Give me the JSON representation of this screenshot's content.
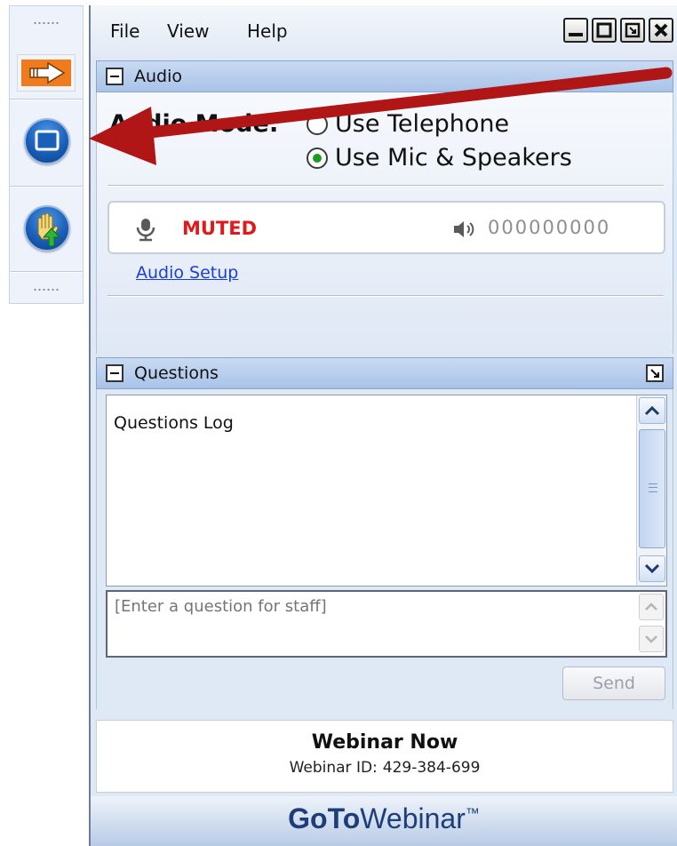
{
  "window": {
    "menu": [
      "File",
      "View",
      "Help"
    ],
    "controls": [
      "minimize-icon",
      "maximize-icon",
      "restore-icon",
      "close-icon"
    ]
  },
  "toolbar": {
    "items": [
      "arrow-right-icon",
      "screen-share-icon",
      "raise-hand-icon"
    ]
  },
  "audio": {
    "title": "Audio",
    "mode_label": "Audio Mode:",
    "options": [
      {
        "label": "Use Telephone",
        "selected": false
      },
      {
        "label": "Use Mic & Speakers",
        "selected": true
      }
    ],
    "mic_status": "MUTED",
    "speaker_level": "000000000",
    "setup_link": "Audio Setup"
  },
  "questions": {
    "title": "Questions",
    "log_text": "Questions Log",
    "input_placeholder": "[Enter a question for staff]",
    "send_label": "Send"
  },
  "webinar": {
    "name": "Webinar Now",
    "id_label": "Webinar ID:",
    "id_value": "429-384-699"
  },
  "brand": {
    "bold": "GoTo",
    "light": "Webinar",
    "tm": "™"
  },
  "colors": {
    "muted_red": "#e01a1a",
    "link_blue": "#1a3fd6",
    "annotation_red": "#b01616",
    "radio_green": "#1c9a24",
    "brand_navy": "#1d3e78"
  }
}
